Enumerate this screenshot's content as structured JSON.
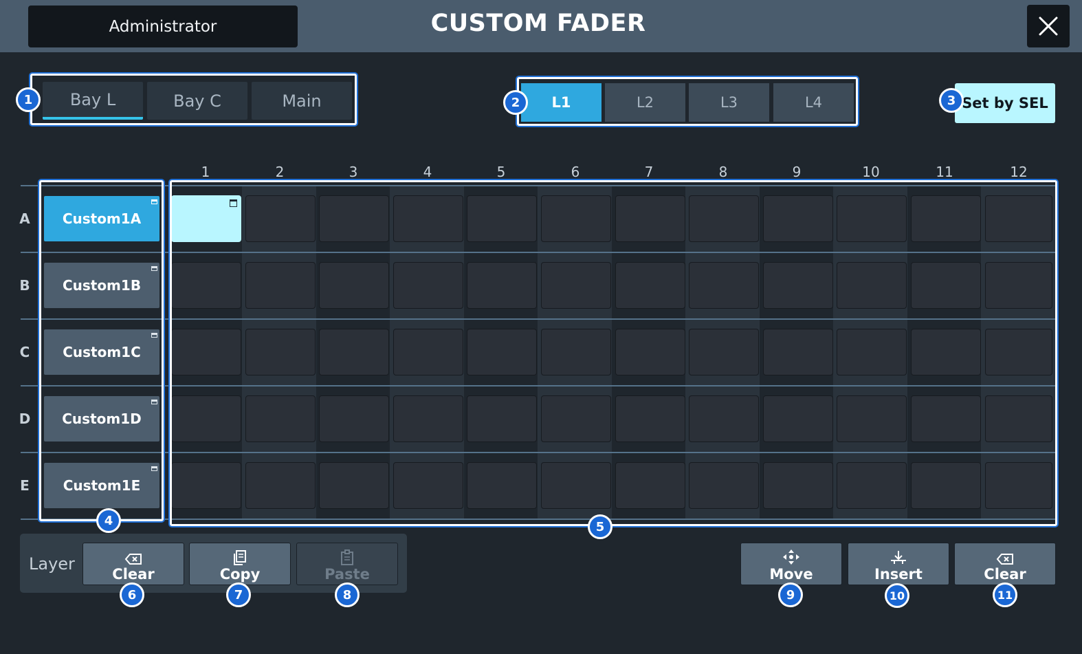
{
  "header": {
    "user": "Administrator",
    "title": "CUSTOM FADER",
    "close_icon": "close-icon"
  },
  "bay_tabs": [
    {
      "label": "Bay L",
      "active": true
    },
    {
      "label": "Bay C",
      "active": false
    },
    {
      "label": "Main",
      "active": false
    }
  ],
  "layer_tabs": [
    {
      "label": "L1",
      "active": true
    },
    {
      "label": "L2",
      "active": false
    },
    {
      "label": "L3",
      "active": false
    },
    {
      "label": "L4",
      "active": false
    }
  ],
  "set_by_sel": "Set by SEL",
  "grid": {
    "columns": [
      "1",
      "2",
      "3",
      "4",
      "5",
      "6",
      "7",
      "8",
      "9",
      "10",
      "11",
      "12"
    ],
    "rows": [
      {
        "label": "A",
        "button": "Custom1A",
        "active": true
      },
      {
        "label": "B",
        "button": "Custom1B",
        "active": false
      },
      {
        "label": "C",
        "button": "Custom1C",
        "active": false
      },
      {
        "label": "D",
        "button": "Custom1D",
        "active": false
      },
      {
        "label": "E",
        "button": "Custom1E",
        "active": false
      }
    ],
    "selected_cell": {
      "row": "A",
      "column": "1"
    }
  },
  "layer_bar": {
    "label": "Layer",
    "clear": "Clear",
    "copy": "Copy",
    "paste": "Paste",
    "paste_enabled": false
  },
  "edit_bar": {
    "move": "Move",
    "insert": "Insert",
    "clear": "Clear"
  },
  "callouts": [
    "1",
    "2",
    "3",
    "4",
    "5",
    "6",
    "7",
    "8",
    "9",
    "10",
    "11"
  ],
  "colors": {
    "accent": "#2fa8df",
    "highlight": "#b9f6ff",
    "callout": "#1a67d4",
    "titlebar": "#4a5c6d"
  }
}
